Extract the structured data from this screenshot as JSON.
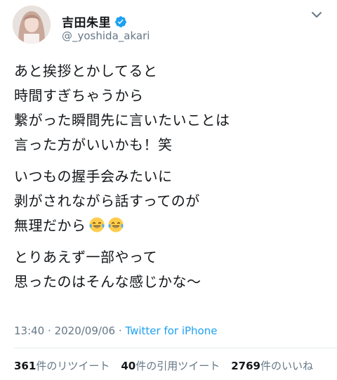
{
  "tweet": {
    "author": {
      "display_name": "吉田朱里",
      "handle": "@_yoshida_akari",
      "verified": true,
      "avatar": "profile-photo"
    },
    "paragraphs": [
      {
        "lines": [
          "あと挨拶とかしてると",
          "時間すぎちゃうから",
          "繋がった瞬間先に言いたいことは",
          "言った方がいいかも！笑"
        ]
      },
      {
        "lines": [
          "いつもの握手会みたいに",
          "剥がされながら話すってのが",
          "無理だから"
        ],
        "emoji": [
          "face-with-tears-of-joy",
          "face-with-tears-of-joy"
        ]
      },
      {
        "lines": [
          "とりあえず一部やって",
          "思ったのはそんな感じかな〜"
        ]
      }
    ],
    "time": "13:40",
    "separator": "·",
    "date": "2020/09/06",
    "source": "Twitter for iPhone",
    "stats": {
      "retweets": {
        "count": "361",
        "label": "件のリツイート"
      },
      "quotes": {
        "count": "40",
        "label": "件の引用ツイート"
      },
      "likes": {
        "count": "2769",
        "label": "件のいいね"
      }
    },
    "colors": {
      "link": "#1da1f2",
      "muted": "#657786",
      "text": "#14171a",
      "divider": "#e6ecf0"
    }
  }
}
